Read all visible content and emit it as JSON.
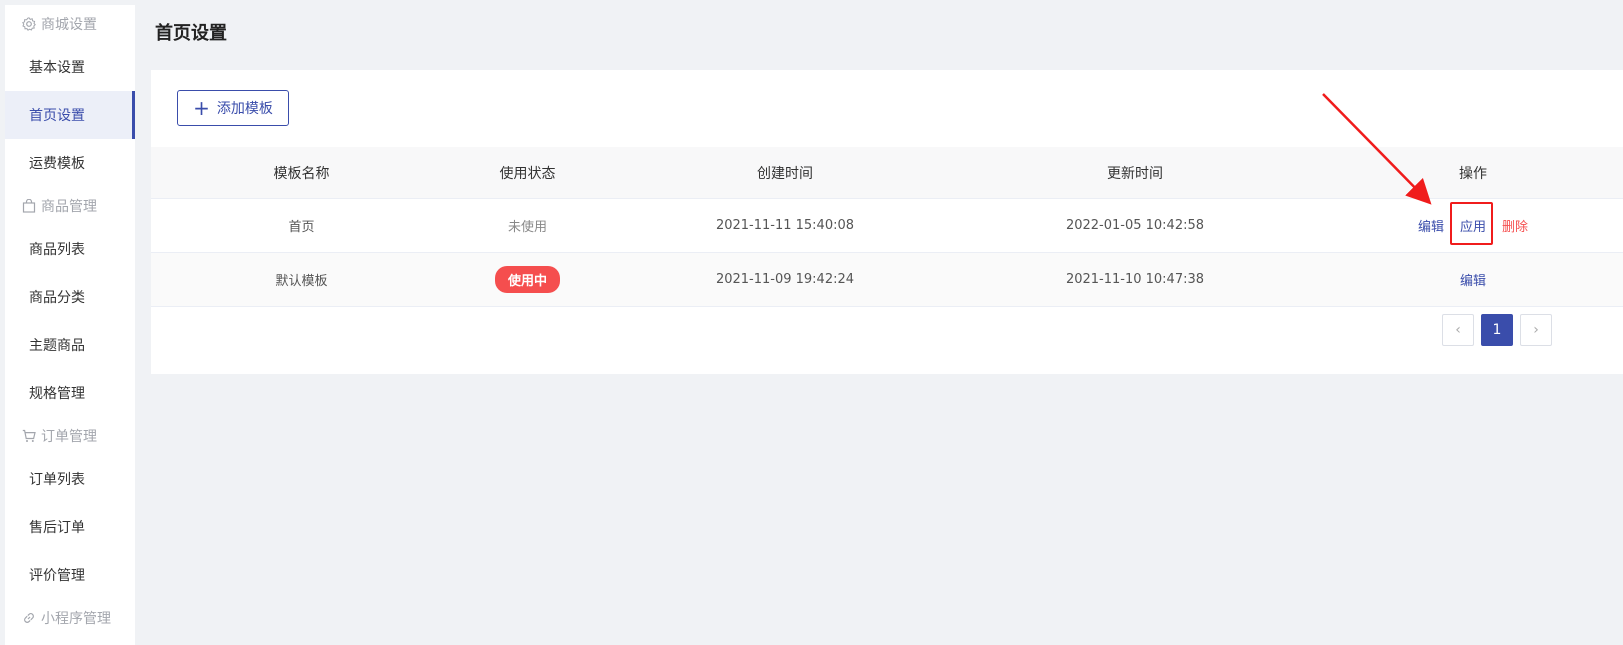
{
  "sidebar": {
    "groups": [
      {
        "title": "商城设置",
        "icon": "gear-icon",
        "items": [
          "基本设置",
          "首页设置",
          "运费模板"
        ]
      },
      {
        "title": "商品管理",
        "icon": "shopping-bag-icon",
        "items": [
          "商品列表",
          "商品分类",
          "主题商品",
          "规格管理"
        ]
      },
      {
        "title": "订单管理",
        "icon": "cart-icon",
        "items": [
          "订单列表",
          "售后订单",
          "评价管理"
        ]
      },
      {
        "title": "小程序管理",
        "icon": "link-icon",
        "items": []
      }
    ],
    "active_item": "首页设置"
  },
  "page": {
    "title": "首页设置"
  },
  "toolbar": {
    "add_label": "添加模板"
  },
  "table": {
    "headers": [
      "模板名称",
      "使用状态",
      "创建时间",
      "更新时间",
      "操作"
    ],
    "rows": [
      {
        "name": "首页",
        "status": "未使用",
        "created": "2021-11-11 15:40:08",
        "updated": "2022-01-05 10:42:58",
        "actions": [
          "编辑",
          "应用",
          "删除"
        ]
      },
      {
        "name": "默认模板",
        "status": "使用中",
        "created": "2021-11-09 19:42:24",
        "updated": "2021-11-10 10:47:38",
        "actions": [
          "编辑"
        ]
      }
    ]
  },
  "pagination": {
    "prev": "‹",
    "current": "1",
    "next": "›"
  },
  "colors": {
    "accent": "#3a4dab",
    "danger": "#f54e4e",
    "annotation": "#f01c1c"
  }
}
